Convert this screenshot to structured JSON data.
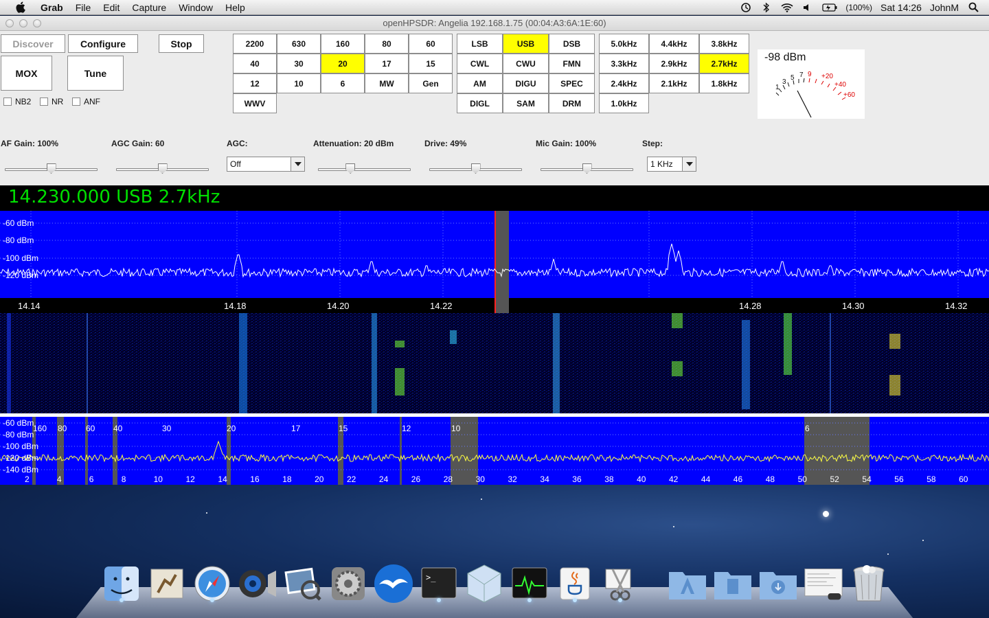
{
  "menubar": {
    "app": "Grab",
    "items": [
      "File",
      "Edit",
      "Capture",
      "Window",
      "Help"
    ],
    "battery": "(100%)",
    "clock": "Sat 14:26",
    "user": "JohnM"
  },
  "window": {
    "title": "openHPSDR: Angelia 192.168.1.75 (00:04:A3:6A:1E:60)"
  },
  "toolbar": {
    "discover": "Discover",
    "configure": "Configure",
    "stop": "Stop",
    "mox": "MOX",
    "tune": "Tune",
    "nb2": "NB2",
    "nr": "NR",
    "anf": "ANF"
  },
  "bands": {
    "row1": [
      "2200",
      "630",
      "160",
      "80",
      "60"
    ],
    "row2": [
      "40",
      "30",
      "20",
      "17",
      "15"
    ],
    "row3": [
      "12",
      "10",
      "6",
      "MW",
      "Gen"
    ],
    "row4": [
      "WWV"
    ],
    "selected": "20"
  },
  "modes": {
    "row1": [
      "LSB",
      "USB",
      "DSB"
    ],
    "row2": [
      "CWL",
      "CWU",
      "FMN"
    ],
    "row3": [
      "AM",
      "DIGU",
      "SPEC"
    ],
    "row4": [
      "DIGL",
      "SAM",
      "DRM"
    ],
    "selected": "USB"
  },
  "filters": {
    "row1": [
      "5.0kHz",
      "4.4kHz",
      "3.8kHz"
    ],
    "row2": [
      "3.3kHz",
      "2.9kHz",
      "2.7kHz"
    ],
    "row3": [
      "2.4kHz",
      "2.1kHz",
      "1.8kHz"
    ],
    "row4": [
      "1.0kHz"
    ],
    "selected": "2.7kHz"
  },
  "meter": {
    "reading": "-98 dBm",
    "scale_black": [
      "1",
      "3",
      "5",
      "7"
    ],
    "scale_red": [
      "9",
      "+20",
      "+40",
      "+60"
    ]
  },
  "gains": {
    "af": {
      "label": "AF Gain: 100%",
      "value": 0.5
    },
    "agc_gain": {
      "label": "AGC Gain: 60",
      "value": 0.5
    },
    "agc": {
      "label": "AGC:",
      "value": "Off"
    },
    "attenuation": {
      "label": "Attenuation: 20 dBm",
      "value": 0.35
    },
    "drive": {
      "label": "Drive: 49%",
      "value": 0.5
    },
    "mic": {
      "label": "Mic Gain: 100%",
      "value": 0.5
    },
    "step": {
      "label": "Step:",
      "value": "1 KHz"
    }
  },
  "frequency_display": "14.230.000 USB 2.7kHz",
  "panadapter": {
    "db_labels": [
      "-60 dBm",
      "-80 dBm",
      "-100 dBm",
      "-120 dBm"
    ],
    "freq_ticks": [
      "14.14",
      "14.18",
      "14.20",
      "14.22",
      "14.28",
      "14.30",
      "14.32"
    ]
  },
  "bandscope": {
    "db_labels": [
      "-60 dBm",
      "-80 dBm",
      "-100 dBm",
      "-120 dBm",
      "-140 dBm"
    ],
    "band_labels": [
      "160",
      "80",
      "60",
      "40",
      "30",
      "20",
      "17",
      "15",
      "12",
      "10",
      "6"
    ],
    "freq_ticks": [
      "2",
      "4",
      "6",
      "8",
      "10",
      "12",
      "14",
      "16",
      "18",
      "20",
      "22",
      "24",
      "26",
      "28",
      "30",
      "32",
      "34",
      "36",
      "38",
      "40",
      "42",
      "44",
      "46",
      "48",
      "50",
      "52",
      "54",
      "56",
      "58",
      "60"
    ]
  },
  "colors": {
    "spectrum_bg": "#0000ff",
    "highlight": "#ffff00",
    "freq_text": "#00e000"
  }
}
